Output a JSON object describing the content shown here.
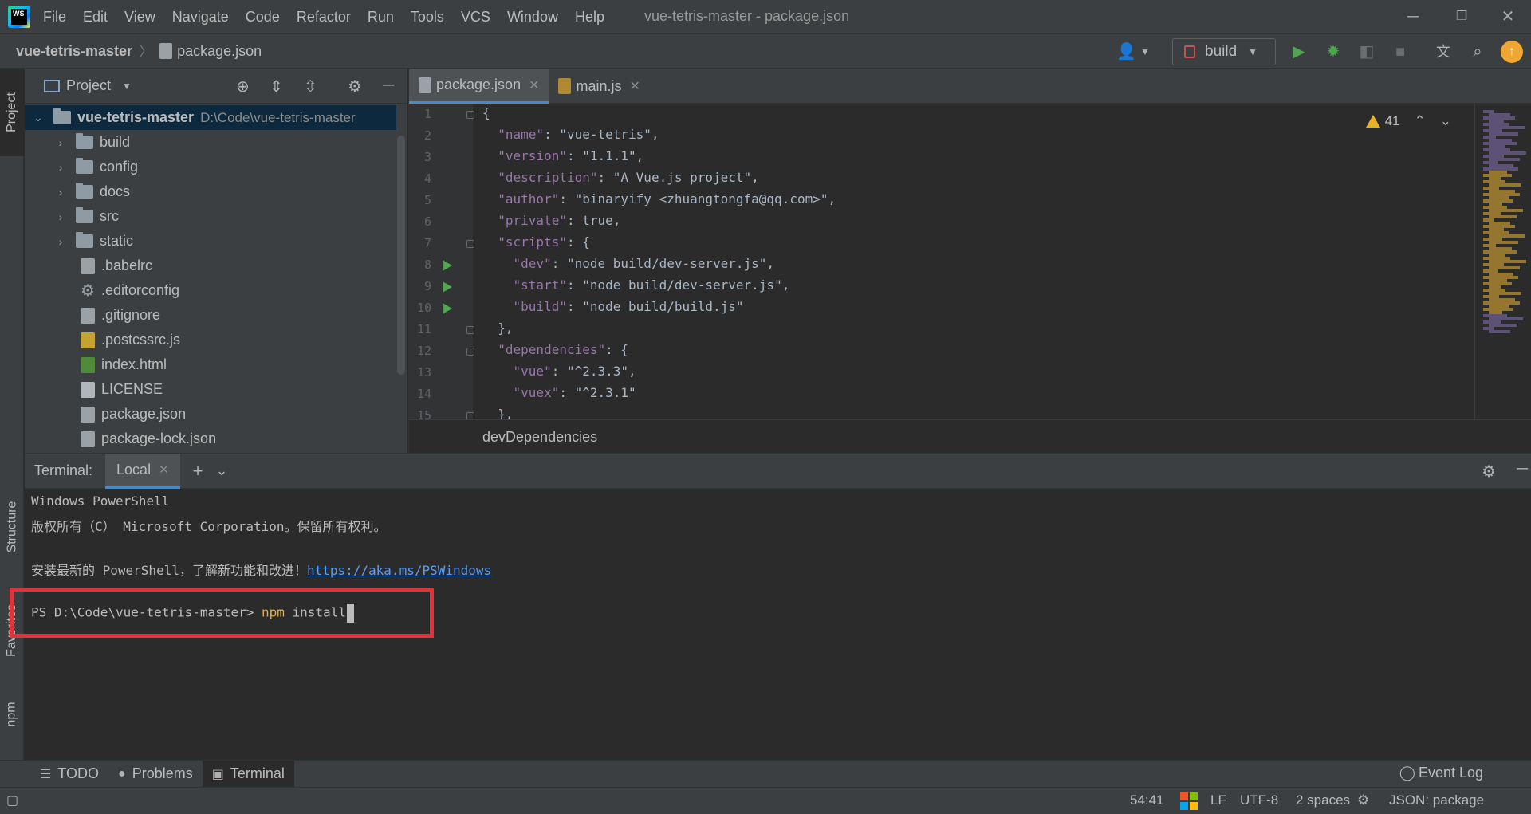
{
  "app": {
    "logo_text": "WS",
    "window_title": "vue-tetris-master - package.json",
    "menu": [
      "File",
      "Edit",
      "View",
      "Navigate",
      "Code",
      "Refactor",
      "Run",
      "Tools",
      "VCS",
      "Window",
      "Help"
    ]
  },
  "navbar": {
    "project": "vue-tetris-master",
    "file": "package.json",
    "run_config": "build"
  },
  "left_stripe": {
    "project_tab": "Project",
    "structure_tab": "Structure",
    "favorites_tab": "Favorites",
    "npm_tab": "npm"
  },
  "project_panel": {
    "title": "Project",
    "root": {
      "name": "vue-tetris-master",
      "path": "D:\\Code\\vue-tetris-master"
    },
    "folders": [
      "build",
      "config",
      "docs",
      "src",
      "static"
    ],
    "files": [
      {
        "name": ".babelrc",
        "icon": "config-file-icon"
      },
      {
        "name": ".editorconfig",
        "icon": "gear-file-icon"
      },
      {
        "name": ".gitignore",
        "icon": "config-file-icon"
      },
      {
        "name": ".postcssrc.js",
        "icon": "js-file-icon"
      },
      {
        "name": "index.html",
        "icon": "html-file-icon"
      },
      {
        "name": "LICENSE",
        "icon": "text-file-icon"
      },
      {
        "name": "package.json",
        "icon": "json-file-icon"
      },
      {
        "name": "package-lock.json",
        "icon": "json-file-icon"
      }
    ]
  },
  "editor": {
    "tabs": [
      {
        "label": "package.json",
        "active": true
      },
      {
        "label": "main.js",
        "active": false
      }
    ],
    "warning_count": "41",
    "breadcrumb": "devDependencies",
    "line_numbers": [
      "1",
      "2",
      "3",
      "4",
      "5",
      "6",
      "7",
      "8",
      "9",
      "10",
      "11",
      "12",
      "13",
      "14",
      "15"
    ],
    "lines": [
      "{",
      "  \"name\": \"vue-tetris\",",
      "  \"version\": \"1.1.1\",",
      "  \"description\": \"A Vue.js project\",",
      "  \"author\": \"binaryify <zhuangtongfa@qq.com>\",",
      "  \"private\": true,",
      "  \"scripts\": {",
      "    \"dev\": \"node build/dev-server.js\",",
      "    \"start\": \"node build/dev-server.js\",",
      "    \"build\": \"node build/build.js\"",
      "  },",
      "  \"dependencies\": {",
      "    \"vue\": \"^2.3.3\",",
      "    \"vuex\": \"^2.3.1\"",
      "  },"
    ]
  },
  "terminal": {
    "label": "Terminal:",
    "tab": "Local",
    "lines": {
      "l1": "Windows PowerShell",
      "l2": "版权所有（C） Microsoft Corporation。保留所有权利。",
      "l3_prefix": "安装最新的 PowerShell，了解新功能和改进！",
      "l3_link": "https://aka.ms/PSWindows",
      "prompt": "PS D:\\Code\\vue-tetris-master> ",
      "cmd": "npm",
      "args": " install"
    }
  },
  "bottom_tools": {
    "todo": "TODO",
    "problems": "Problems",
    "terminal": "Terminal",
    "event_log": "Event Log"
  },
  "statusbar": {
    "position": "54:41",
    "line_sep": "LF",
    "encoding": "UTF-8",
    "indent": "2 spaces",
    "schema": "JSON: package"
  },
  "colors": {
    "highlight_box": "#e2323a",
    "accent": "#4a88c7",
    "run_green": "#4fa64f"
  }
}
